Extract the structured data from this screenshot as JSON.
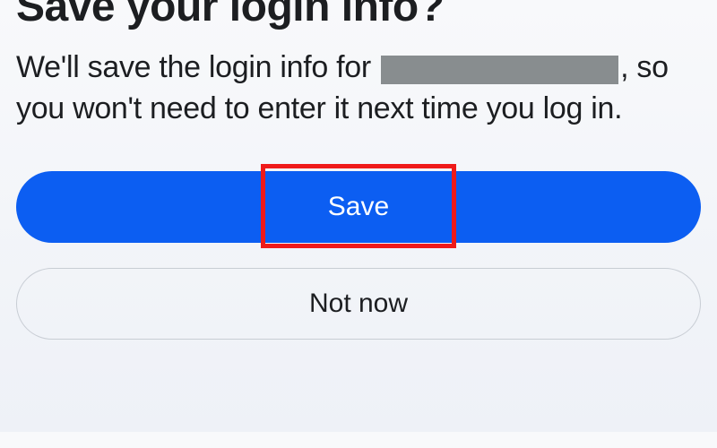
{
  "dialog": {
    "title": "Save your login info?",
    "description_prefix": "We'll save the login info for",
    "description_suffix": ", so you won't need to enter it next time you log in.",
    "save_label": "Save",
    "not_now_label": "Not now"
  }
}
